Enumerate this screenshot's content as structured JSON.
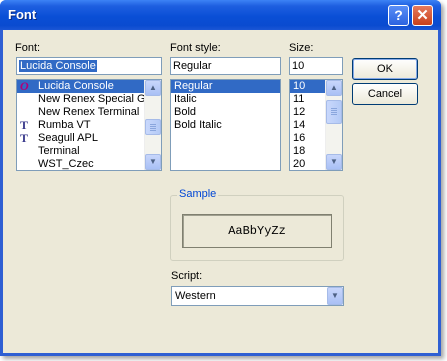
{
  "window": {
    "title": "Font",
    "help_glyph": "?",
    "close_glyph": "✕"
  },
  "font": {
    "label": "Font:",
    "value": "Lucida Console",
    "items": [
      {
        "name": "Lucida Console",
        "icon": "opentype-icon",
        "glyph": "O",
        "selected": true
      },
      {
        "name": "New Renex Special Gr",
        "icon": "none",
        "glyph": ""
      },
      {
        "name": "New Renex Terminal",
        "icon": "none",
        "glyph": ""
      },
      {
        "name": "Rumba VT",
        "icon": "truetype-icon",
        "glyph": "T"
      },
      {
        "name": "Seagull APL",
        "icon": "truetype-icon",
        "glyph": "T"
      },
      {
        "name": "Terminal",
        "icon": "none",
        "glyph": ""
      },
      {
        "name": "WST_Czec",
        "icon": "none",
        "glyph": ""
      }
    ]
  },
  "style": {
    "label": "Font style:",
    "value": "Regular",
    "items": [
      "Regular",
      "Italic",
      "Bold",
      "Bold Italic"
    ],
    "selected_index": 0
  },
  "size": {
    "label": "Size:",
    "value": "10",
    "items": [
      "10",
      "11",
      "12",
      "14",
      "16",
      "18",
      "20"
    ],
    "selected_index": 0
  },
  "buttons": {
    "ok": "OK",
    "cancel": "Cancel"
  },
  "sample": {
    "label": "Sample",
    "text": "AaBbYyZz"
  },
  "script": {
    "label": "Script:",
    "value": "Western"
  }
}
